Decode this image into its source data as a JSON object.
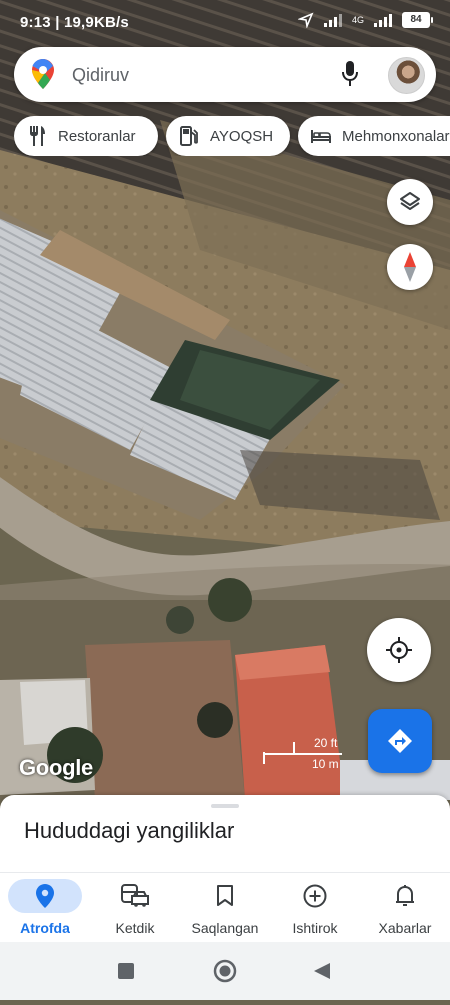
{
  "status_bar": {
    "time": "9:13",
    "speed": "19,9KB/s",
    "network": "4G",
    "battery": "84"
  },
  "search": {
    "placeholder": "Qidiruv"
  },
  "chips": [
    {
      "label": "Restoranlar",
      "icon": "fork-knife-icon"
    },
    {
      "label": "AYOQSH",
      "icon": "gas-station-icon"
    },
    {
      "label": "Mehmonxonalar",
      "icon": "bed-icon"
    }
  ],
  "map": {
    "attribution": "Google",
    "scale_ft": "20 ft",
    "scale_m": "10 m"
  },
  "sheet": {
    "title": "Hududdagi yangiliklar"
  },
  "nav": {
    "items": [
      {
        "label": "Atrofda",
        "icon": "location-pin-icon",
        "active": true
      },
      {
        "label": "Ketdik",
        "icon": "commute-icon",
        "active": false
      },
      {
        "label": "Saqlangan",
        "icon": "bookmark-icon",
        "active": false
      },
      {
        "label": "Ishtirok",
        "icon": "add-circle-icon",
        "active": false
      },
      {
        "label": "Xabarlar",
        "icon": "bell-icon",
        "active": false
      }
    ]
  },
  "colors": {
    "accent": "#1a73e8",
    "active_pill": "#d2e3fc"
  }
}
